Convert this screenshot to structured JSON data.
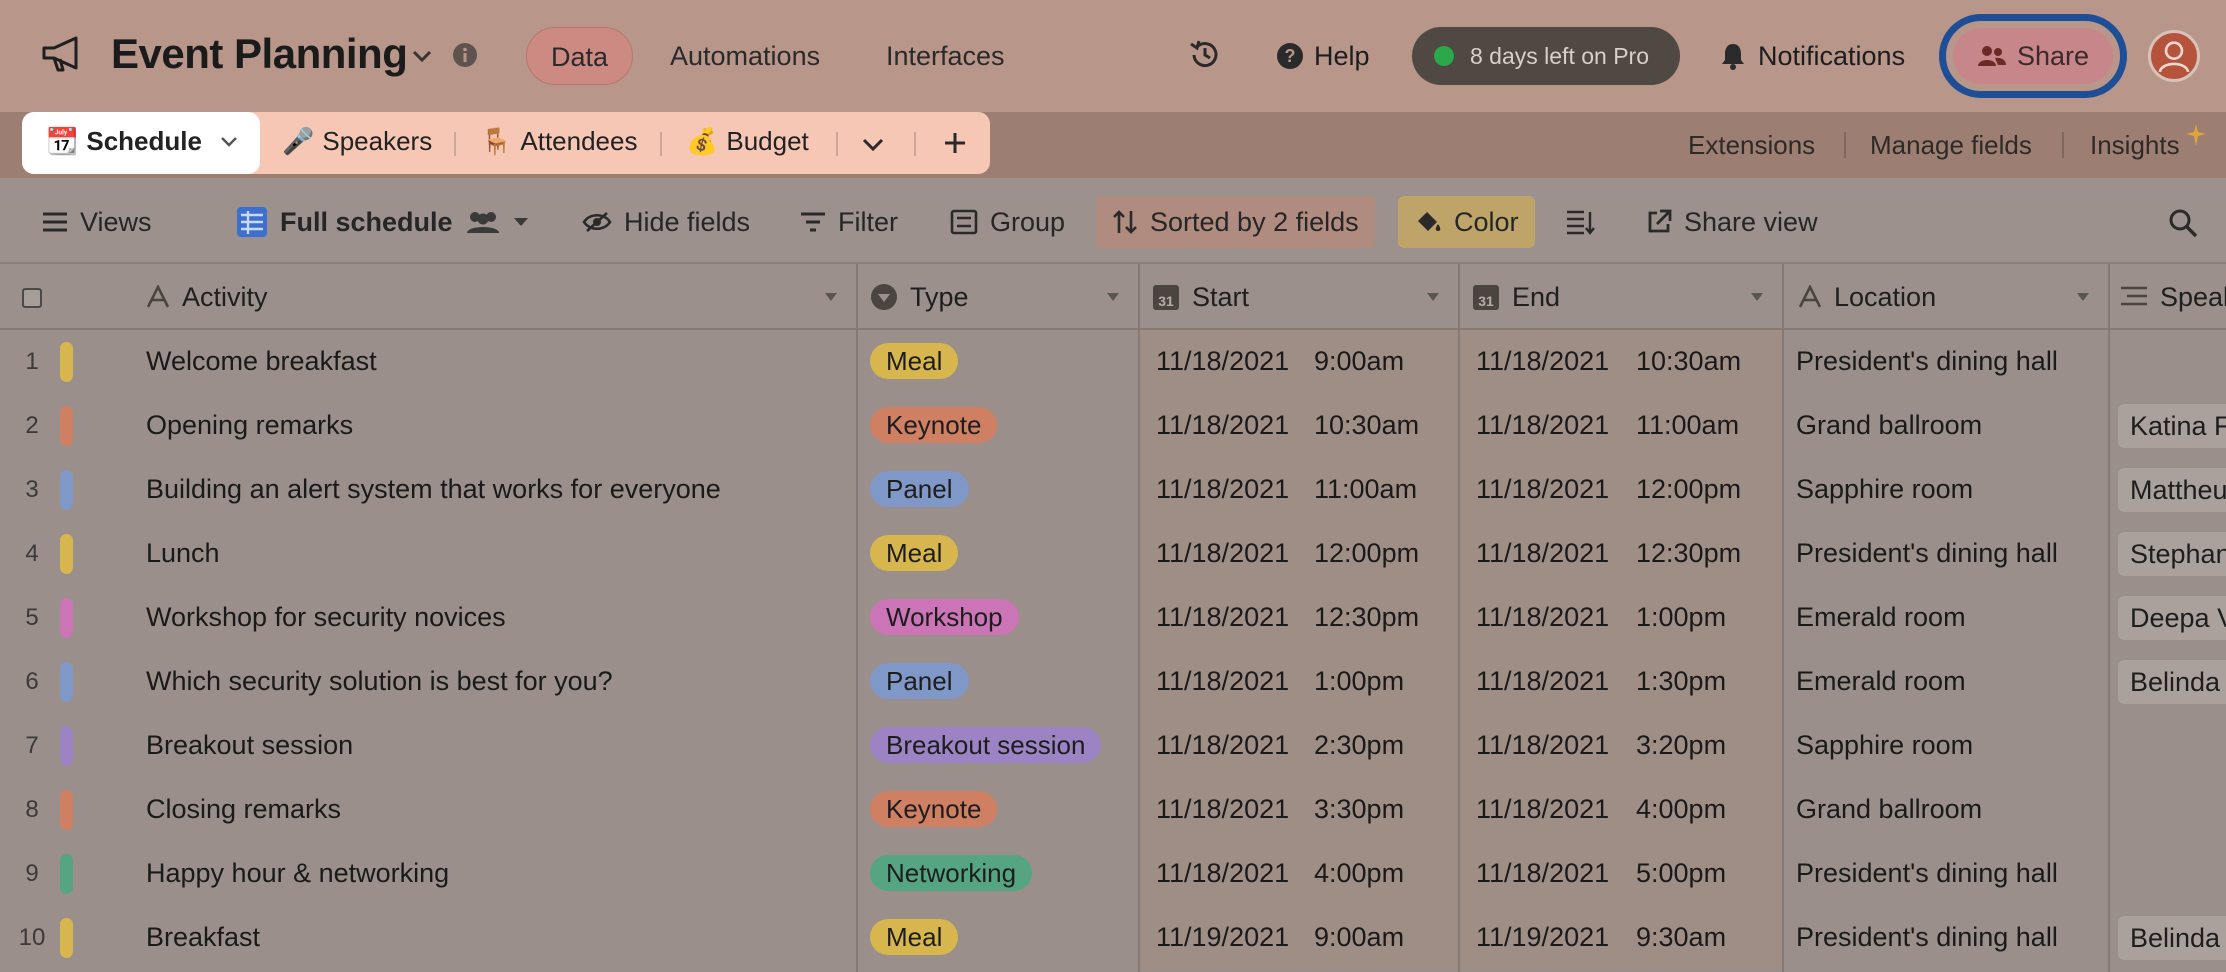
{
  "app": {
    "title": "Event Planning",
    "nav": [
      "Data",
      "Automations",
      "Interfaces"
    ],
    "help_label": "Help",
    "trial_label": "8 days left on Pro",
    "notifications_label": "Notifications",
    "share_label": "Share"
  },
  "tables": {
    "tabs": [
      {
        "label": "Schedule",
        "emoji": "📆"
      },
      {
        "label": "Speakers",
        "emoji": "🎤"
      },
      {
        "label": "Attendees",
        "emoji": "🪑"
      },
      {
        "label": "Budget",
        "emoji": "💰"
      }
    ],
    "right_links": [
      "Extensions",
      "Manage fields",
      "Insights"
    ]
  },
  "toolbar": {
    "views_label": "Views",
    "view_name": "Full schedule",
    "hide_fields": "Hide fields",
    "filter": "Filter",
    "group": "Group",
    "sort": "Sorted by 2 fields",
    "color": "Color",
    "share_view": "Share view"
  },
  "columns": [
    "Activity",
    "Type",
    "Start",
    "End",
    "Location",
    "Speal"
  ],
  "type_colors": {
    "Meal": "#d8b64e",
    "Keynote": "#cf8062",
    "Panel": "#7f98c8",
    "Workshop": "#cb74b6",
    "Breakout session": "#9c84c4",
    "Networking": "#55a582"
  },
  "rows": [
    {
      "n": "1",
      "activity": "Welcome breakfast",
      "type": "Meal",
      "start_date": "11/18/2021",
      "start_time": "9:00am",
      "end_date": "11/18/2021",
      "end_time": "10:30am",
      "location": "President's dining hall",
      "speaker": ""
    },
    {
      "n": "2",
      "activity": "Opening remarks",
      "type": "Keynote",
      "start_date": "11/18/2021",
      "start_time": "10:30am",
      "end_date": "11/18/2021",
      "end_time": "11:00am",
      "location": "Grand ballroom",
      "speaker": "Katina F"
    },
    {
      "n": "3",
      "activity": "Building an alert system that works for everyone",
      "type": "Panel",
      "start_date": "11/18/2021",
      "start_time": "11:00am",
      "end_date": "11/18/2021",
      "end_time": "12:00pm",
      "location": "Sapphire room",
      "speaker": "Mattheu"
    },
    {
      "n": "4",
      "activity": "Lunch",
      "type": "Meal",
      "start_date": "11/18/2021",
      "start_time": "12:00pm",
      "end_date": "11/18/2021",
      "end_time": "12:30pm",
      "location": "President's dining hall",
      "speaker": "Stephan"
    },
    {
      "n": "5",
      "activity": "Workshop for security novices",
      "type": "Workshop",
      "start_date": "11/18/2021",
      "start_time": "12:30pm",
      "end_date": "11/18/2021",
      "end_time": "1:00pm",
      "location": "Emerald room",
      "speaker": "Deepa V"
    },
    {
      "n": "6",
      "activity": "Which security solution is best for you?",
      "type": "Panel",
      "start_date": "11/18/2021",
      "start_time": "1:00pm",
      "end_date": "11/18/2021",
      "end_time": "1:30pm",
      "location": "Emerald room",
      "speaker": "Belinda C"
    },
    {
      "n": "7",
      "activity": "Breakout session",
      "type": "Breakout session",
      "start_date": "11/18/2021",
      "start_time": "2:30pm",
      "end_date": "11/18/2021",
      "end_time": "3:20pm",
      "location": "Sapphire room",
      "speaker": ""
    },
    {
      "n": "8",
      "activity": "Closing remarks",
      "type": "Keynote",
      "start_date": "11/18/2021",
      "start_time": "3:30pm",
      "end_date": "11/18/2021",
      "end_time": "4:00pm",
      "location": "Grand ballroom",
      "speaker": ""
    },
    {
      "n": "9",
      "activity": "Happy hour & networking",
      "type": "Networking",
      "start_date": "11/18/2021",
      "start_time": "4:00pm",
      "end_date": "11/18/2021",
      "end_time": "5:00pm",
      "location": "President's dining hall",
      "speaker": ""
    },
    {
      "n": "10",
      "activity": "Breakfast",
      "type": "Meal",
      "start_date": "11/19/2021",
      "start_time": "9:00am",
      "end_date": "11/19/2021",
      "end_time": "9:30am",
      "location": "President's dining hall",
      "speaker": "Belinda C"
    }
  ]
}
